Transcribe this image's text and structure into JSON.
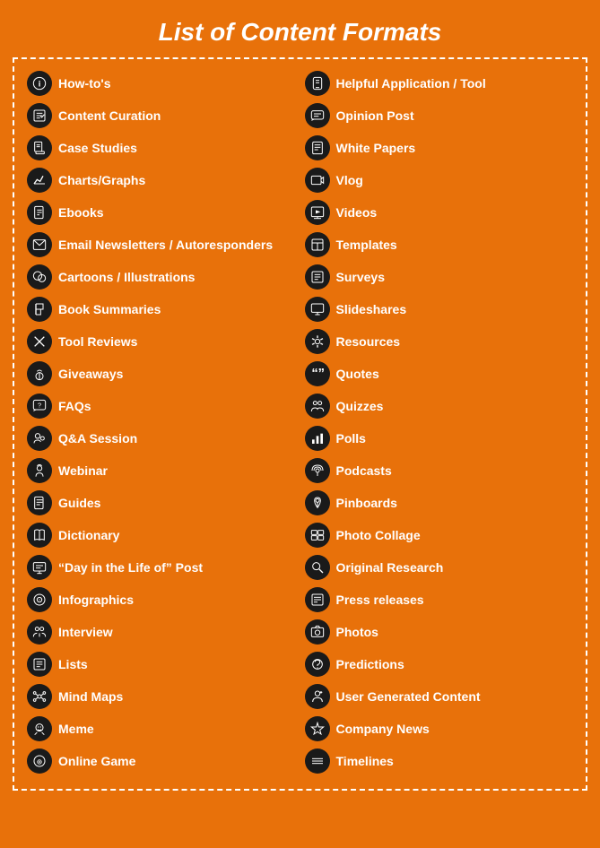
{
  "title": "List of Content Formats",
  "colors": {
    "background": "#E8710A",
    "icon_bg": "#1a1a1a",
    "text": "#ffffff"
  },
  "left_column": [
    {
      "label": "How-to's",
      "icon": "ℹ",
      "icon_name": "howtos-icon"
    },
    {
      "label": "Content Curation",
      "icon": "✎",
      "icon_name": "content-curation-icon"
    },
    {
      "label": "Case Studies",
      "icon": "📋",
      "icon_name": "case-studies-icon"
    },
    {
      "label": "Charts/Graphs",
      "icon": "📈",
      "icon_name": "charts-graphs-icon"
    },
    {
      "label": "Ebooks",
      "icon": "📖",
      "icon_name": "ebooks-icon"
    },
    {
      "label": "Email Newsletters / Autoresponders",
      "icon": "✉",
      "icon_name": "email-newsletters-icon"
    },
    {
      "label": "Cartoons / Illustrations",
      "icon": "✏",
      "icon_name": "cartoons-icon"
    },
    {
      "label": "Book Summaries",
      "icon": "✔",
      "icon_name": "book-summaries-icon"
    },
    {
      "label": "Tool Reviews",
      "icon": "✂",
      "icon_name": "tool-reviews-icon"
    },
    {
      "label": "Giveaways",
      "icon": "🎁",
      "icon_name": "giveaways-icon"
    },
    {
      "label": "FAQs",
      "icon": "💬",
      "icon_name": "faqs-icon"
    },
    {
      "label": "Q&A Session",
      "icon": "👥",
      "icon_name": "qa-session-icon"
    },
    {
      "label": "Webinar",
      "icon": "🎓",
      "icon_name": "webinar-icon"
    },
    {
      "label": "Guides",
      "icon": "📑",
      "icon_name": "guides-icon"
    },
    {
      "label": "Dictionary",
      "icon": "📚",
      "icon_name": "dictionary-icon"
    },
    {
      "label": "“Day in the Life of” Post",
      "icon": "💻",
      "icon_name": "day-in-life-icon"
    },
    {
      "label": "Infographics",
      "icon": "◎",
      "icon_name": "infographics-icon"
    },
    {
      "label": "Interview",
      "icon": "👤",
      "icon_name": "interview-icon"
    },
    {
      "label": "Lists",
      "icon": "📝",
      "icon_name": "lists-icon"
    },
    {
      "label": "Mind Maps",
      "icon": "🧠",
      "icon_name": "mind-maps-icon"
    },
    {
      "label": "Meme",
      "icon": "🚩",
      "icon_name": "meme-icon"
    },
    {
      "label": "Online Game",
      "icon": "⊕",
      "icon_name": "online-game-icon"
    }
  ],
  "right_column": [
    {
      "label": "Helpful Application / Tool",
      "icon": "📱",
      "icon_name": "helpful-app-icon"
    },
    {
      "label": "Opinion Post",
      "icon": "💬",
      "icon_name": "opinion-post-icon"
    },
    {
      "label": "White Papers",
      "icon": "📄",
      "icon_name": "white-papers-icon"
    },
    {
      "label": "Vlog",
      "icon": "📷",
      "icon_name": "vlog-icon"
    },
    {
      "label": "Videos",
      "icon": "🖥",
      "icon_name": "videos-icon"
    },
    {
      "label": "Templates",
      "icon": "📋",
      "icon_name": "templates-icon"
    },
    {
      "label": "Surveys",
      "icon": "📝",
      "icon_name": "surveys-icon"
    },
    {
      "label": "Slideshares",
      "icon": "🖥",
      "icon_name": "slideshares-icon"
    },
    {
      "label": "Resources",
      "icon": "💡",
      "icon_name": "resources-icon"
    },
    {
      "label": "Quotes",
      "icon": "❝",
      "icon_name": "quotes-icon"
    },
    {
      "label": "Quizzes",
      "icon": "👥",
      "icon_name": "quizzes-icon"
    },
    {
      "label": "Polls",
      "icon": "📊",
      "icon_name": "polls-icon"
    },
    {
      "label": "Podcasts",
      "icon": "📡",
      "icon_name": "podcasts-icon"
    },
    {
      "label": "Pinboards",
      "icon": "📌",
      "icon_name": "pinboards-icon"
    },
    {
      "label": "Photo Collage",
      "icon": "🖼",
      "icon_name": "photo-collage-icon"
    },
    {
      "label": "Original Research",
      "icon": "🔍",
      "icon_name": "original-research-icon"
    },
    {
      "label": "Press releases",
      "icon": "📰",
      "icon_name": "press-releases-icon"
    },
    {
      "label": "Photos",
      "icon": "🖼",
      "icon_name": "photos-icon"
    },
    {
      "label": "Predictions",
      "icon": "⚙",
      "icon_name": "predictions-icon"
    },
    {
      "label": "User Generated Content",
      "icon": "👤",
      "icon_name": "user-generated-icon"
    },
    {
      "label": "Company News",
      "icon": "📢",
      "icon_name": "company-news-icon"
    },
    {
      "label": "Timelines",
      "icon": "≡",
      "icon_name": "timelines-icon"
    }
  ]
}
